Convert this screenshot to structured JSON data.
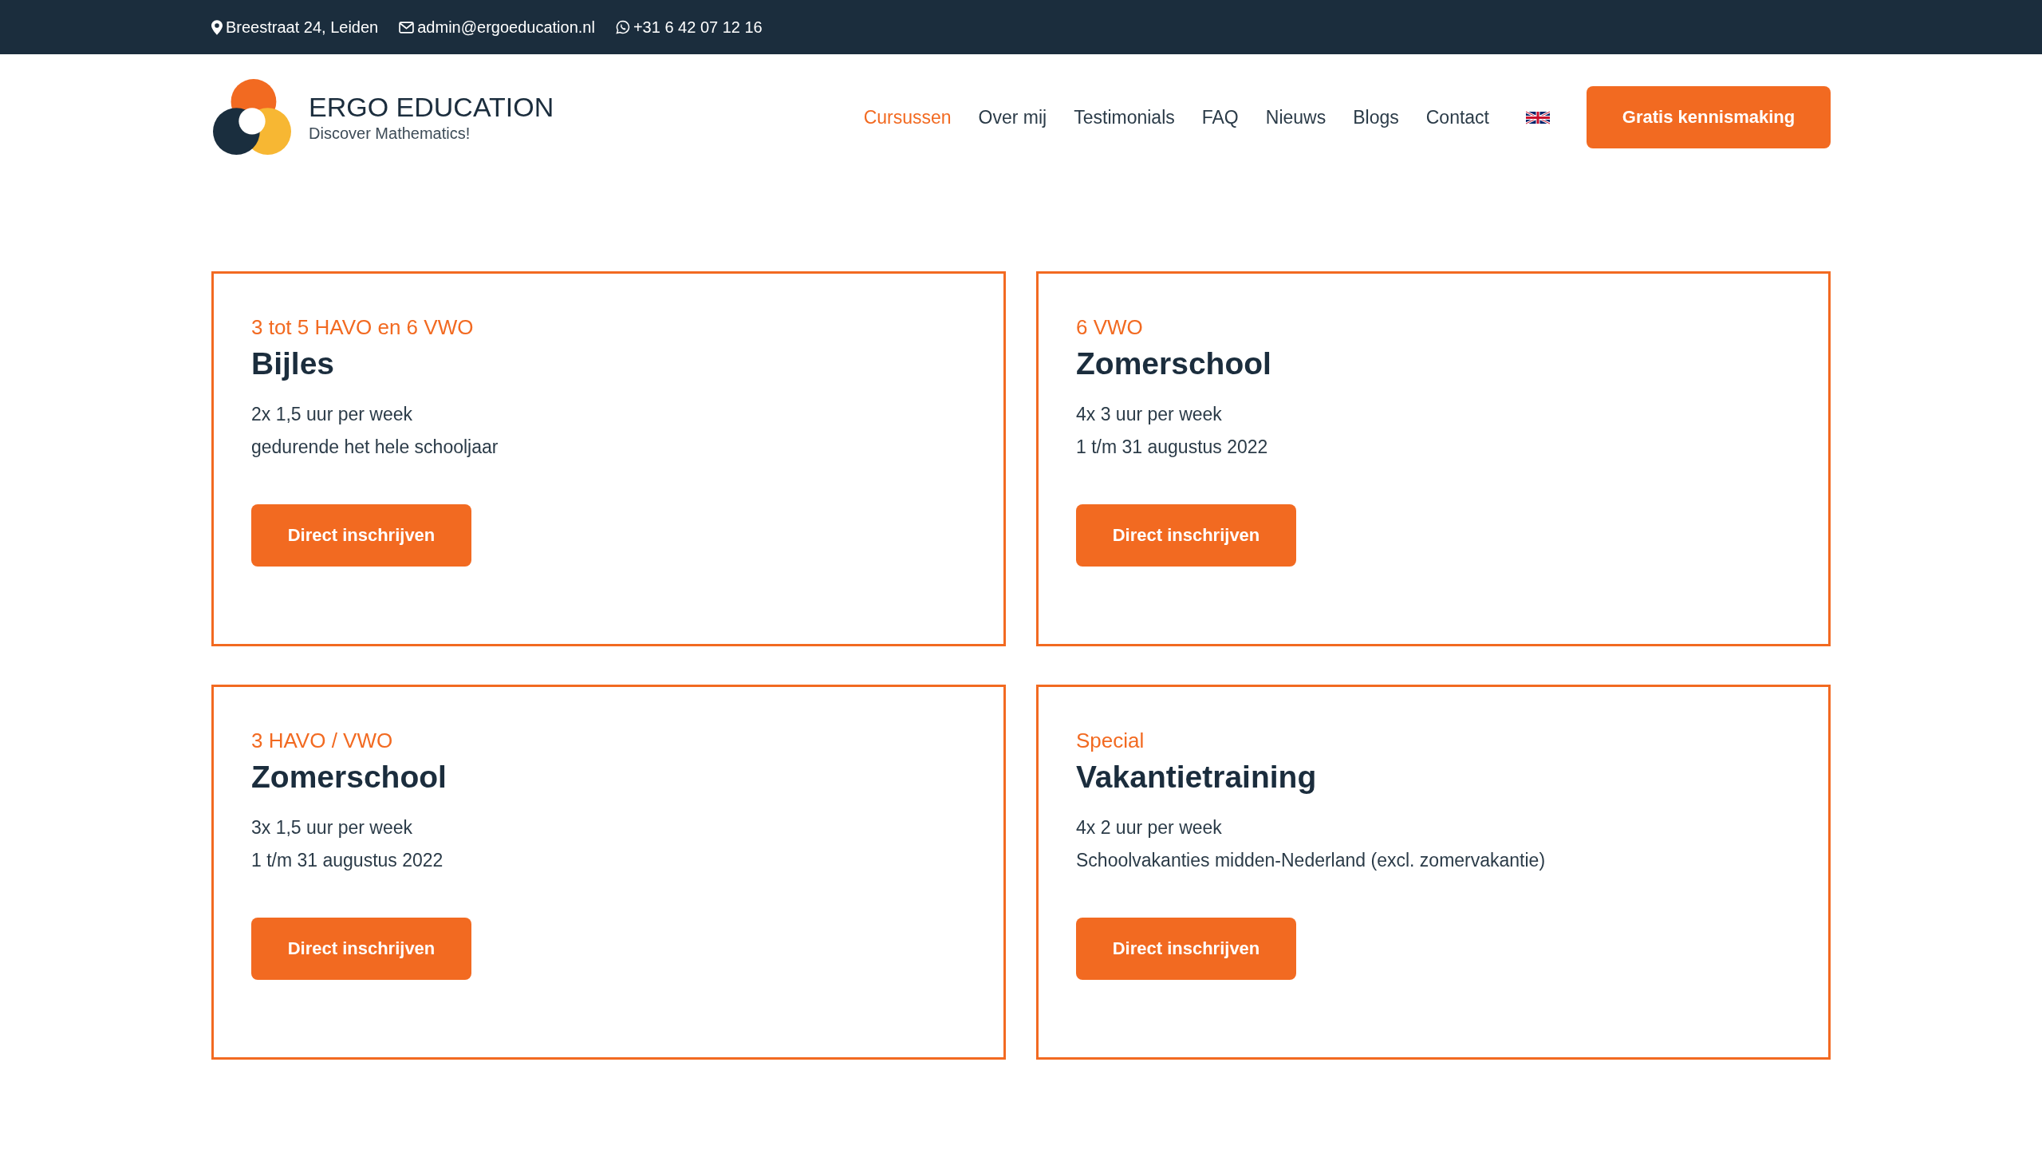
{
  "top_bar": {
    "address": "Breestraat 24, Leiden",
    "email": "admin@ergoeducation.nl",
    "phone": "+31 6 42 07 12 16"
  },
  "logo": {
    "name": "ERGO EDUCATION",
    "tagline": "Discover Mathematics!"
  },
  "nav": [
    {
      "label": "Cursussen",
      "selected": true
    },
    {
      "label": "Over mij",
      "selected": false
    },
    {
      "label": "Testimonials",
      "selected": false
    },
    {
      "label": "FAQ",
      "selected": false
    },
    {
      "label": "Nieuws",
      "selected": false
    },
    {
      "label": "Blogs",
      "selected": false
    },
    {
      "label": "Contact",
      "selected": false
    }
  ],
  "cta_button": "Gratis kennismaking",
  "courses": [
    {
      "level": "3 tot 5 HAVO en 6 VWO",
      "title": "Bijles",
      "lines": [
        "2x 1,5 uur per week",
        "gedurende het hele schooljaar"
      ],
      "button": "Direct inschrijven"
    },
    {
      "level": "6 VWO",
      "title": "Zomerschool",
      "lines": [
        "4x 3 uur per week",
        "1 t/m 31 augustus 2022"
      ],
      "button": "Direct inschrijven"
    },
    {
      "level": "3 HAVO / VWO",
      "title": "Zomerschool",
      "lines": [
        "3x 1,5 uur per week",
        "1 t/m 31 augustus 2022"
      ],
      "button": "Direct inschrijven"
    },
    {
      "level": "Special",
      "title": "Vakantietraining",
      "lines": [
        "4x 2 uur per week",
        "Schoolvakanties midden-Nederland (excl. zomervakantie)"
      ],
      "button": "Direct inschrijven"
    }
  ]
}
